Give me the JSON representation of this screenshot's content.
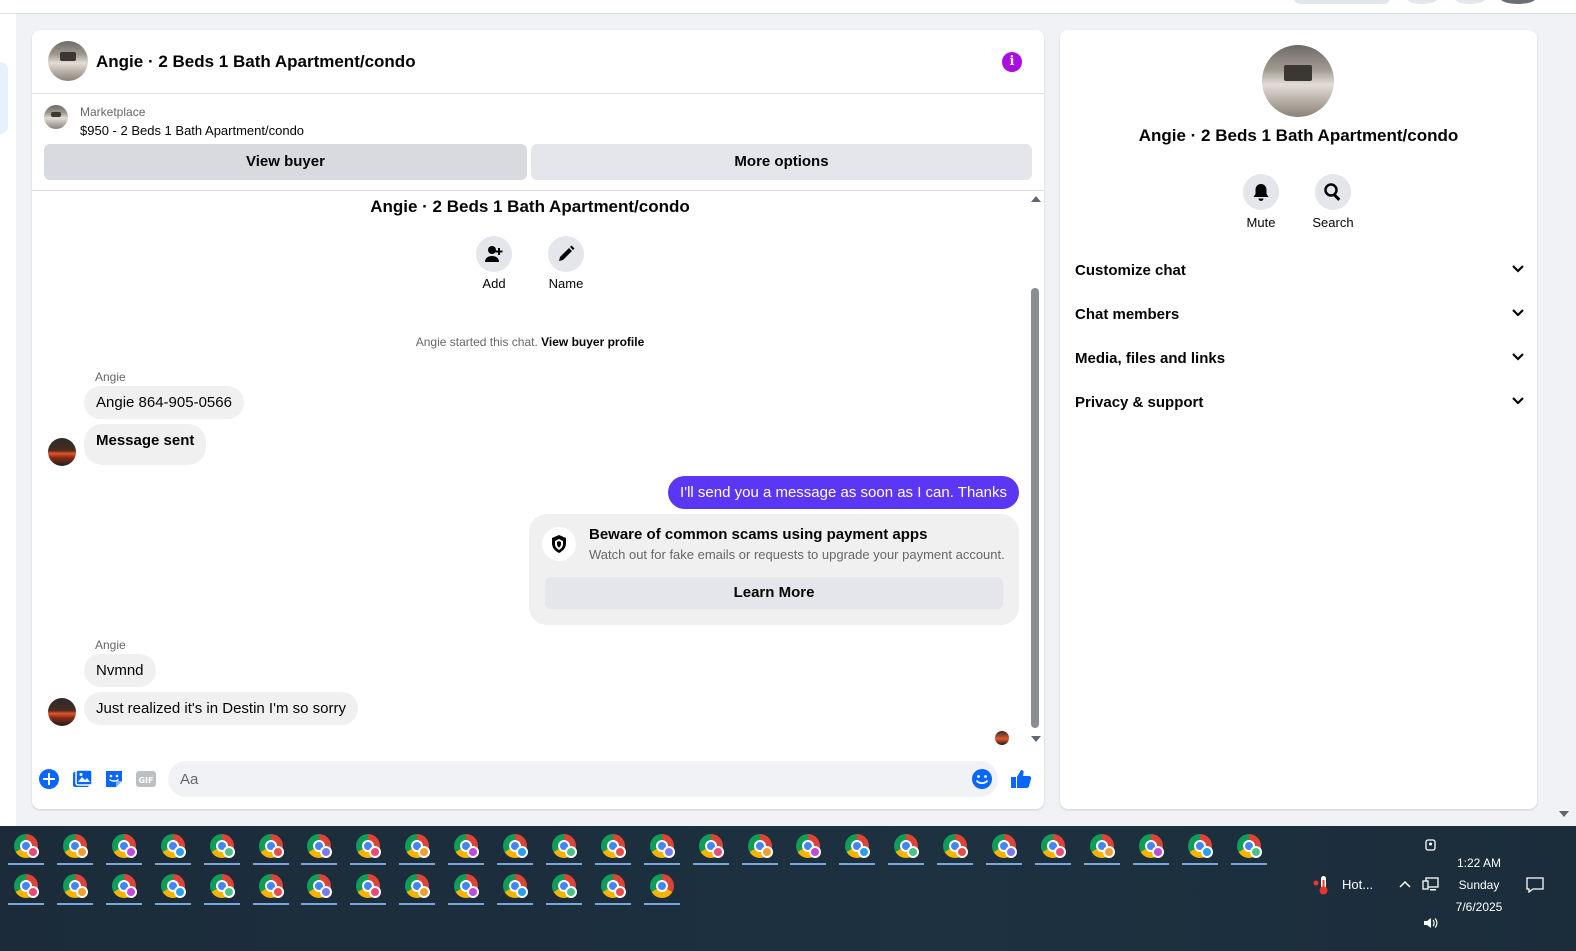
{
  "conversation": {
    "title": "Angie · 2 Beds 1 Bath Apartment/condo"
  },
  "marketplace": {
    "label": "Marketplace",
    "listing": "$950 - 2 Beds 1 Bath Apartment/condo",
    "view_buyer": "View buyer",
    "more_options": "More options"
  },
  "thread": {
    "title": "Angie · 2 Beds 1 Bath Apartment/condo",
    "add_label": "Add",
    "name_label": "Name",
    "started_text": "Angie started this chat. ",
    "view_profile": "View buyer profile",
    "group1": {
      "sender": "Angie",
      "messages": [
        "Angie 864-905-0566",
        "Message sent"
      ]
    },
    "outgoing": "I'll send you a message as soon as I can. Thanks",
    "scam": {
      "title": "Beware of common scams using payment apps",
      "subtitle": "Watch out for fake emails or requests to upgrade your payment account.",
      "button": "Learn More"
    },
    "group2": {
      "sender": "Angie",
      "messages": [
        "Nvmnd",
        "Just realized it's in Destin I'm so sorry"
      ]
    }
  },
  "composer": {
    "placeholder": "Aa"
  },
  "info_panel": {
    "title": "Angie · 2 Beds 1 Bath Apartment/condo",
    "mute": "Mute",
    "search": "Search",
    "sections": [
      "Customize chat",
      "Chat members",
      "Media, files and links",
      "Privacy & support"
    ]
  },
  "taskbar": {
    "weather": "Hot...",
    "time": "1:22 AM",
    "day": "Sunday",
    "date": "7/6/2025"
  },
  "colors": {
    "accent": "#5b37f5",
    "info": "#a90de0",
    "messenger_blue": "#0866ff"
  }
}
